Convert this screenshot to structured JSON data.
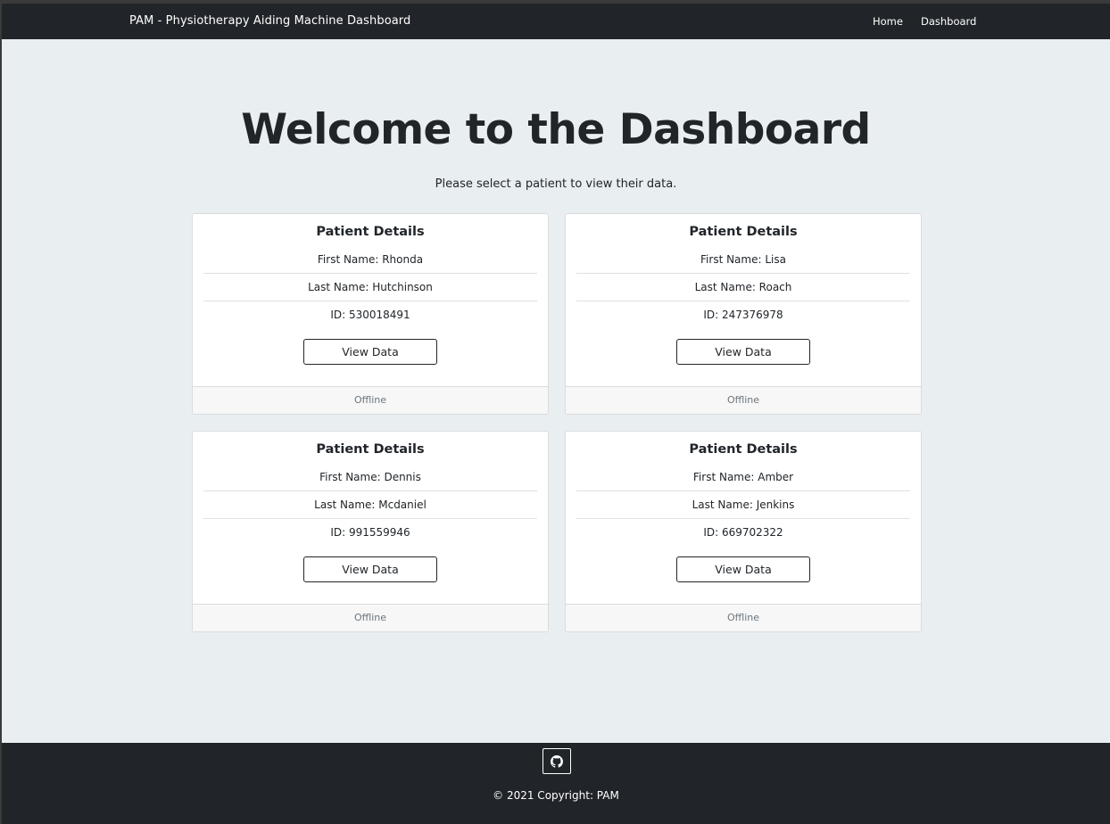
{
  "navbar": {
    "brand": "PAM - Physiotherapy Aiding Machine Dashboard",
    "links": [
      "Home",
      "Dashboard"
    ]
  },
  "hero": {
    "title": "Welcome to the Dashboard",
    "subtitle": "Please select a patient to view their data."
  },
  "patients": [
    {
      "card_title": "Patient Details",
      "first_name": "First Name: Rhonda",
      "last_name": "Last Name: Hutchinson",
      "id": "ID: 530018491",
      "button_label": "View Data",
      "status": "Offline"
    },
    {
      "card_title": "Patient Details",
      "first_name": "First Name: Lisa",
      "last_name": "Last Name: Roach",
      "id": "ID: 247376978",
      "button_label": "View Data",
      "status": "Offline"
    },
    {
      "card_title": "Patient Details",
      "first_name": "First Name: Dennis",
      "last_name": "Last Name: Mcdaniel",
      "id": "ID: 991559946",
      "button_label": "View Data",
      "status": "Offline"
    },
    {
      "card_title": "Patient Details",
      "first_name": "First Name: Amber",
      "last_name": "Last Name: Jenkins",
      "id": "ID: 669702322",
      "button_label": "View Data",
      "status": "Offline"
    }
  ],
  "footer": {
    "github_icon": "github-icon",
    "copyright": "© 2021 Copyright: PAM"
  },
  "colors": {
    "navbar_bg": "#212529",
    "page_bg": "#e9eef0",
    "card_bg": "#ffffff",
    "status_text": "#6c757d"
  }
}
